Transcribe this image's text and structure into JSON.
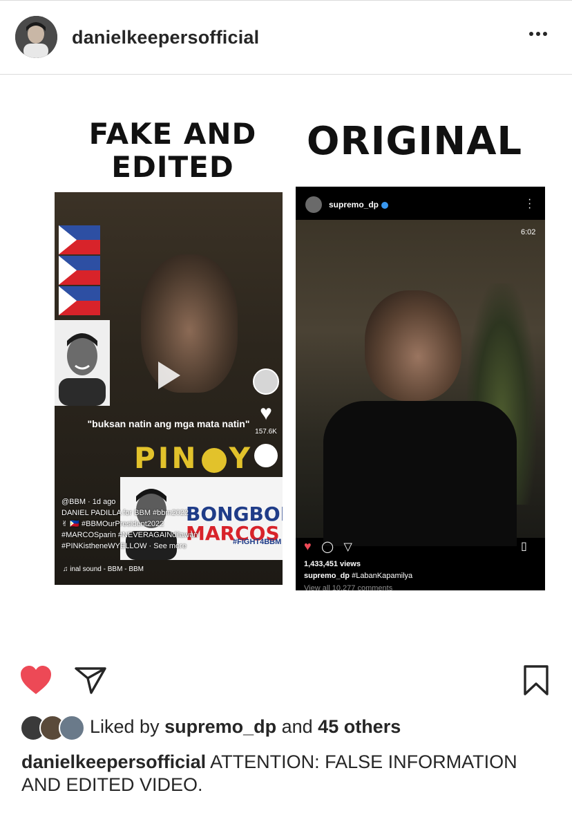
{
  "post": {
    "username": "danielkeepersofficial",
    "more_icon": "more-horizontal-icon"
  },
  "image": {
    "left_title_line1": "FAKE AND",
    "left_title_line2": "EDITED",
    "right_title": "ORIGINAL",
    "fake": {
      "quote": "\"buksan natin ang mga mata natin\"",
      "pinoy_left": "PIN",
      "pinoy_right": "Y",
      "like_count": "157.6K",
      "bong_line1": "BONGBONG",
      "bong_line2": "MARCOS",
      "fight": "#FIGHT4BBM",
      "caption_lines": [
        "@BBM · 1d ago",
        "DANIEL PADILLA for BBM #bbm2022",
        "✌ 🇵🇭 #BBMOurPresident2022",
        "#MARCOSparin #NEVERAGAINdilawan",
        "#PINKistheneWYELLOW · See more"
      ],
      "sound": "♫ inal sound - BBM - BBM"
    },
    "original": {
      "username": "supremo_dp",
      "time": "6:02",
      "views": "1,433,451 views",
      "caption_user": "supremo_dp",
      "caption_text": "#LabanKapamilya",
      "comments": "View all 10,277 comments"
    }
  },
  "actions": {
    "like_icon": "heart-filled-icon",
    "share_icon": "send-icon",
    "save_icon": "bookmark-icon",
    "like_color": "#ed4956"
  },
  "likes": {
    "prefix": "Liked by ",
    "user": "supremo_dp",
    "middle": " and ",
    "others": "45 others"
  },
  "caption": {
    "user": "danielkeepersofficial",
    "text": " ATTENTION: FALSE INFORMATION AND EDITED VIDEO."
  }
}
